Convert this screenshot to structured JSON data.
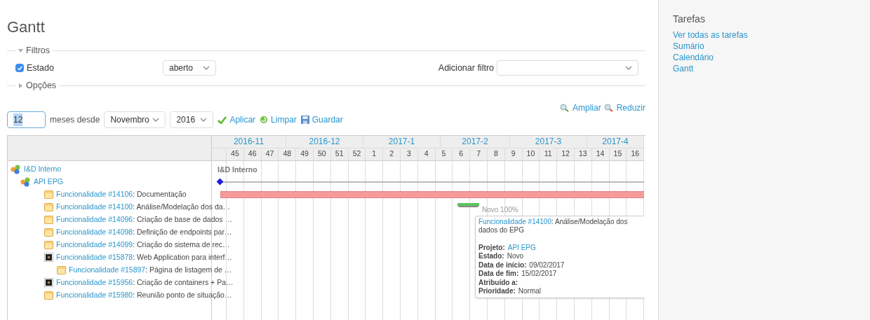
{
  "title": "Gantt",
  "filters": {
    "legend": "Filtros",
    "expanded": true,
    "status": {
      "label": "Estado",
      "checked": true,
      "value": "aberto"
    },
    "add_filter": {
      "label": "Adicionar filtro"
    }
  },
  "options": {
    "legend": "Opções",
    "expanded": false
  },
  "controls": {
    "months": "12",
    "months_label": "meses desde",
    "month": "Novembro",
    "year": "2016",
    "apply": "Aplicar",
    "clear": "Limpar",
    "save": "Guardar",
    "zoom_in": "Ampliar",
    "zoom_out": "Reduzir"
  },
  "gantt": {
    "months": [
      "2016-11",
      "2016-12",
      "2017-1",
      "2017-2",
      "2017-3",
      "2017-4"
    ],
    "weeks": [
      "45",
      "46",
      "47",
      "48",
      "49",
      "50",
      "51",
      "52",
      "1",
      "2",
      "3",
      "4",
      "5",
      "6",
      "7",
      "8",
      "9",
      "10",
      "11",
      "12",
      "13",
      "14",
      "15",
      "16"
    ],
    "rows": [
      {
        "kind": "project",
        "link": "I&D Interno",
        "bar": {
          "kind": "label",
          "text": "I&D Interno"
        },
        "children": [
          {
            "kind": "project",
            "link": "API EPG",
            "bar": {
              "kind": "milestone"
            },
            "children": [
              {
                "kind": "task",
                "link": "Funcionalidade #14106",
                "subject": ": Documentação",
                "bar": {
                  "kind": "late"
                }
              },
              {
                "kind": "task",
                "link": "Funcionalidade #14100",
                "subject": ": Análise/Modelação dos da…",
                "bar": {
                  "kind": "task",
                  "level": 1,
                  "text": "Novo 100%"
                }
              },
              {
                "kind": "task",
                "link": "Funcionalidade #14096",
                "subject": ": Criação de base de dados …"
              },
              {
                "kind": "task",
                "link": "Funcionalidade #14098",
                "subject": ": Definição de endpoints par…"
              },
              {
                "kind": "task",
                "link": "Funcionalidade #14099",
                "subject": ": Criação do sistema de rec…"
              },
              {
                "kind": "parent",
                "link": "Funcionalidade #15878",
                "subject": ": Web Application para interf…",
                "children": [
                  {
                    "kind": "task",
                    "link": "Funcionalidade #15897",
                    "subject": ": Página de listagem de …"
                  }
                ]
              },
              {
                "kind": "parent",
                "link": "Funcionalidade #15956",
                "subject": ": Criação de containers + Pa…"
              },
              {
                "kind": "task",
                "link": "Funcionalidade #15980",
                "subject": ": Reunião ponto de situação…"
              }
            ]
          }
        ]
      }
    ],
    "tooltip": {
      "link": "Funcionalidade #14100",
      "subject": ": Análise/Modelação dos dados do EPG",
      "fields": [
        {
          "label": "Projeto:",
          "value": "API EPG",
          "link": true
        },
        {
          "label": "Estado:",
          "value": "Novo",
          "link": false
        },
        {
          "label": "Data de início:",
          "value": "09/02/2017",
          "link": false
        },
        {
          "label": "Data de fim:",
          "value": "15/02/2017",
          "link": false
        },
        {
          "label": "Atribuído a:"
        },
        {
          "label": "Prioridade:",
          "value": "Normal",
          "link": false
        }
      ]
    }
  },
  "sidebar": {
    "title": "Tarefas",
    "links": [
      "Ver todas as tarefas",
      "Sumário",
      "Calendário",
      "Gantt"
    ]
  }
}
